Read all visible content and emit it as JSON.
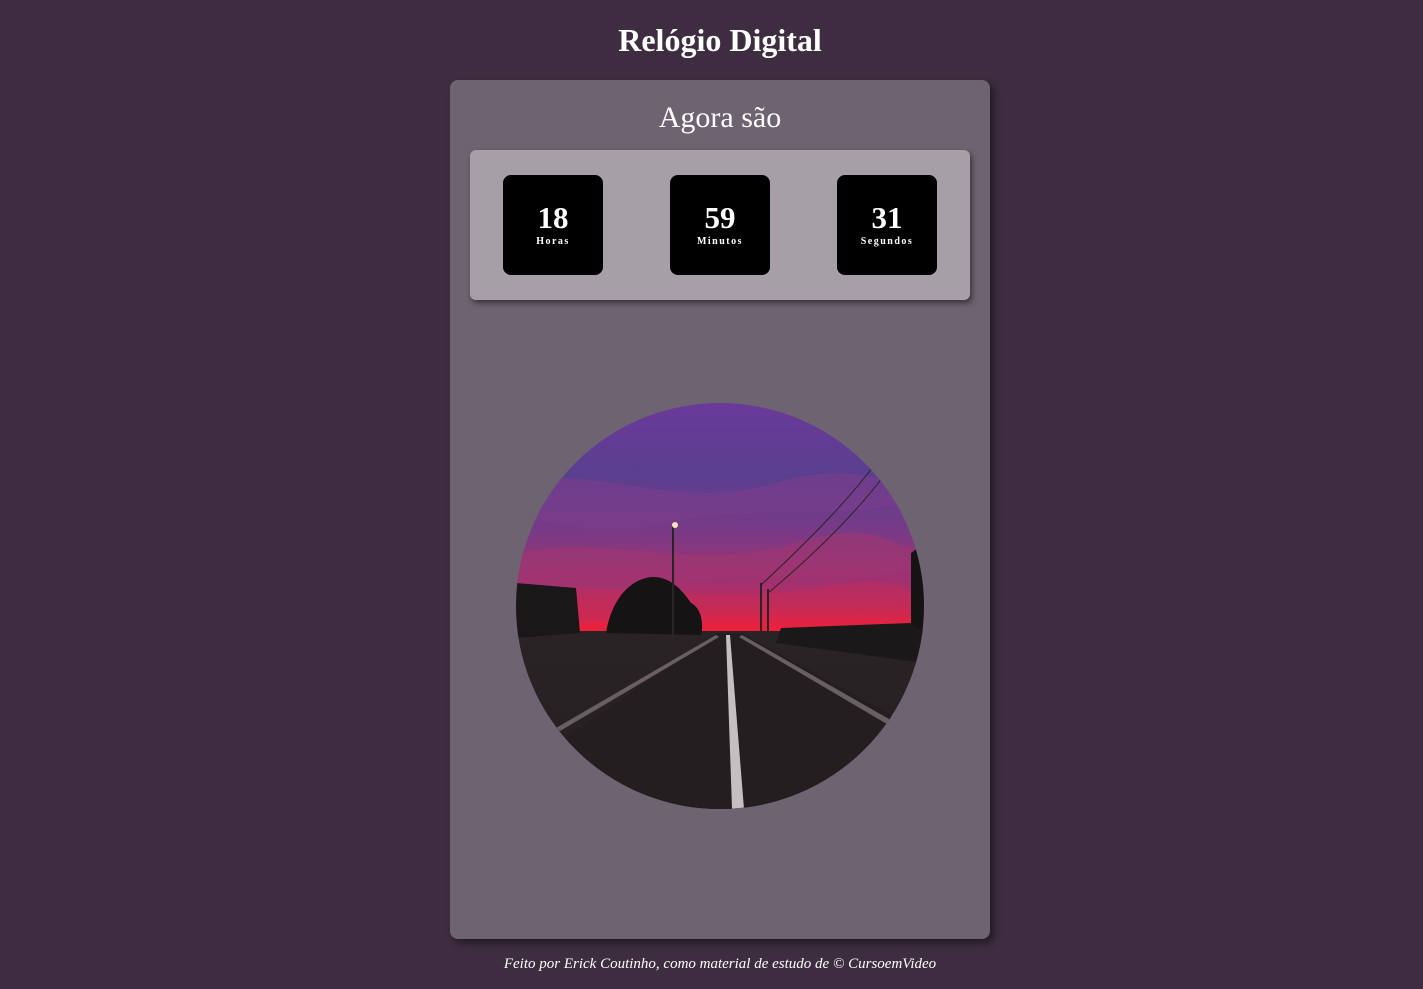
{
  "header": {
    "title": "Relógio Digital"
  },
  "clock": {
    "heading": "Agora são",
    "hours": {
      "value": "18",
      "label": "Horas"
    },
    "minutes": {
      "value": "59",
      "label": "Minutos"
    },
    "seconds": {
      "value": "31",
      "label": "Segundos"
    }
  },
  "image": {
    "subject": "sunset road photo"
  },
  "footer": {
    "text": "Feito por Erick Coutinho, como material de estudo de © CursoemVideo"
  },
  "colors": {
    "background": "#3e2d40",
    "card": "#6e6370",
    "clock_panel": "#a79fa8",
    "digit_box": "#000000",
    "text": "#ffffff"
  }
}
